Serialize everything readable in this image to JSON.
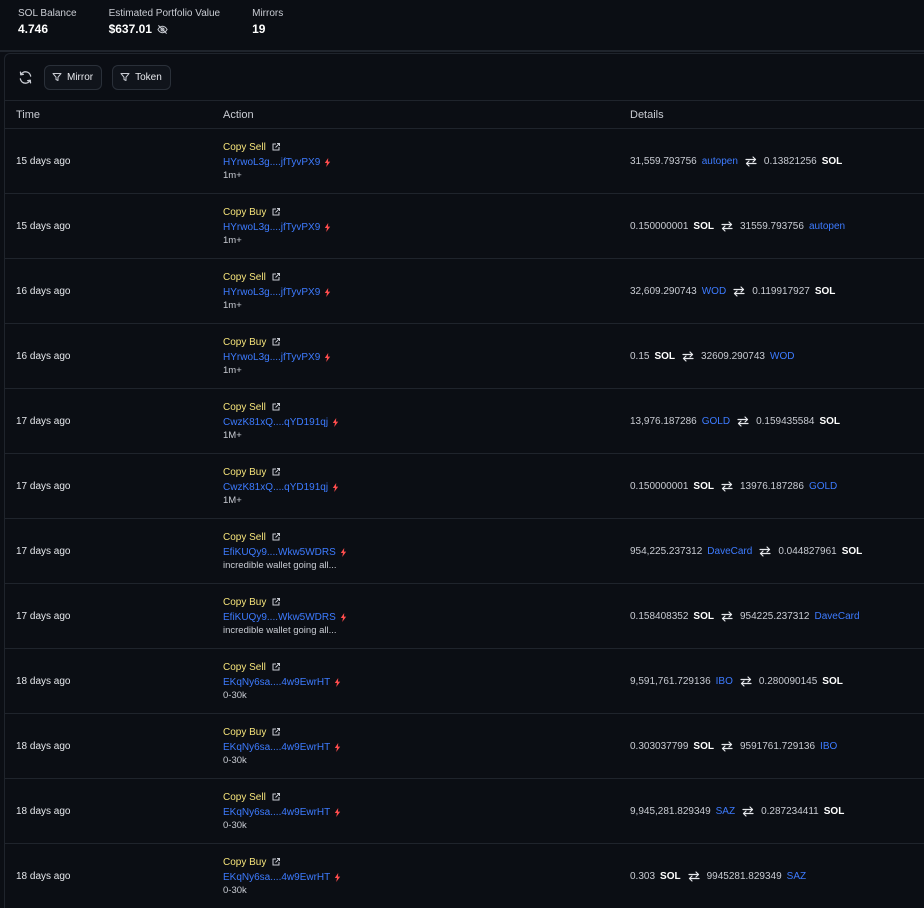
{
  "stats": {
    "sol_balance_label": "SOL Balance",
    "sol_balance_value": "4.746",
    "portfolio_label": "Estimated Portfolio Value",
    "portfolio_value": "$637.01",
    "mirrors_label": "Mirrors",
    "mirrors_value": "19"
  },
  "toolbar": {
    "mirror_label": "Mirror",
    "token_label": "Token"
  },
  "table": {
    "headers": {
      "time": "Time",
      "action": "Action",
      "details": "Details"
    },
    "rows": [
      {
        "time": "15 days ago",
        "action": "Copy Sell",
        "wallet": "HYrwoL3g....jfTyvPX9",
        "note": "1m+",
        "from_amount": "31,559.793756",
        "from_token": "autopen",
        "to_amount": "0.13821256",
        "to_token": "SOL"
      },
      {
        "time": "15 days ago",
        "action": "Copy Buy",
        "wallet": "HYrwoL3g....jfTyvPX9",
        "note": "1m+",
        "from_amount": "0.150000001",
        "from_token": "SOL",
        "to_amount": "31559.793756",
        "to_token": "autopen"
      },
      {
        "time": "16 days ago",
        "action": "Copy Sell",
        "wallet": "HYrwoL3g....jfTyvPX9",
        "note": "1m+",
        "from_amount": "32,609.290743",
        "from_token": "WOD",
        "to_amount": "0.119917927",
        "to_token": "SOL"
      },
      {
        "time": "16 days ago",
        "action": "Copy Buy",
        "wallet": "HYrwoL3g....jfTyvPX9",
        "note": "1m+",
        "from_amount": "0.15",
        "from_token": "SOL",
        "to_amount": "32609.290743",
        "to_token": "WOD"
      },
      {
        "time": "17 days ago",
        "action": "Copy Sell",
        "wallet": "CwzK81xQ....qYD191qj",
        "note": "1M+",
        "from_amount": "13,976.187286",
        "from_token": "GOLD",
        "to_amount": "0.159435584",
        "to_token": "SOL"
      },
      {
        "time": "17 days ago",
        "action": "Copy Buy",
        "wallet": "CwzK81xQ....qYD191qj",
        "note": "1M+",
        "from_amount": "0.150000001",
        "from_token": "SOL",
        "to_amount": "13976.187286",
        "to_token": "GOLD"
      },
      {
        "time": "17 days ago",
        "action": "Copy Sell",
        "wallet": "EfiKUQy9....Wkw5WDRS",
        "note": "incredible wallet going all...",
        "from_amount": "954,225.237312",
        "from_token": "DaveCard",
        "to_amount": "0.044827961",
        "to_token": "SOL"
      },
      {
        "time": "17 days ago",
        "action": "Copy Buy",
        "wallet": "EfiKUQy9....Wkw5WDRS",
        "note": "incredible wallet going all...",
        "from_amount": "0.158408352",
        "from_token": "SOL",
        "to_amount": "954225.237312",
        "to_token": "DaveCard"
      },
      {
        "time": "18 days ago",
        "action": "Copy Sell",
        "wallet": "EKqNy6sa....4w9EwrHT",
        "note": "0-30k",
        "from_amount": "9,591,761.729136",
        "from_token": "IBO",
        "to_amount": "0.280090145",
        "to_token": "SOL"
      },
      {
        "time": "18 days ago",
        "action": "Copy Buy",
        "wallet": "EKqNy6sa....4w9EwrHT",
        "note": "0-30k",
        "from_amount": "0.303037799",
        "from_token": "SOL",
        "to_amount": "9591761.729136",
        "to_token": "IBO"
      },
      {
        "time": "18 days ago",
        "action": "Copy Sell",
        "wallet": "EKqNy6sa....4w9EwrHT",
        "note": "0-30k",
        "from_amount": "9,945,281.829349",
        "from_token": "SAZ",
        "to_amount": "0.287234411",
        "to_token": "SOL"
      },
      {
        "time": "18 days ago",
        "action": "Copy Buy",
        "wallet": "EKqNy6sa....4w9EwrHT",
        "note": "0-30k",
        "from_amount": "0.303",
        "from_token": "SOL",
        "to_amount": "9945281.829349",
        "to_token": "SAZ"
      }
    ]
  },
  "icons": {
    "refresh": "refresh-icon",
    "filter": "filter-icon",
    "external_link": "external-link-icon",
    "bolt": "bolt-icon",
    "swap": "swap-icon",
    "eye_off": "eye-off-icon"
  },
  "colors": {
    "background": "#0b0e14",
    "action": "#f5e37a",
    "link": "#3d7bff",
    "bolt": "#ff4d4d",
    "border": "#1f242c"
  }
}
